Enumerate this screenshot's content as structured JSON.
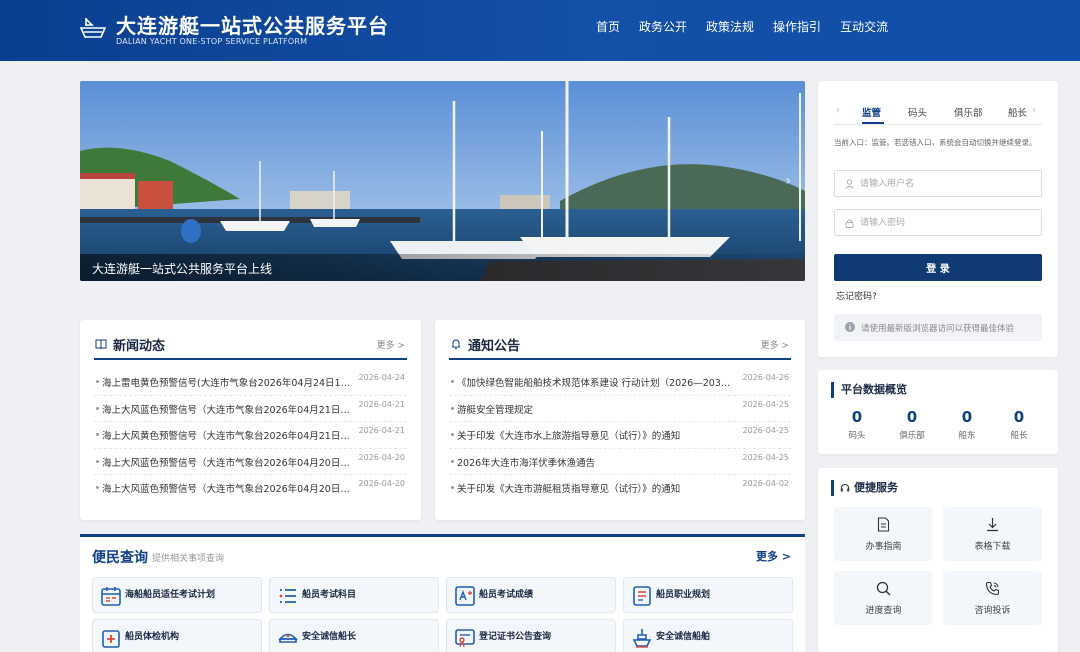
{
  "header": {
    "title": "大连游艇一站式公共服务平台",
    "subtitle": "DALIAN YACHT ONE-STOP SERVICE PLATFORM",
    "nav": [
      "首页",
      "政务公开",
      "政策法规",
      "操作指引",
      "互动交流"
    ]
  },
  "banner": {
    "caption": "大连游艇一站式公共服务平台上线"
  },
  "news": {
    "title": "新闻动态",
    "more": "更多 >",
    "items": [
      {
        "text": "海上雷电黄色预警信号(大连市气象台2026年04月24日19时5…",
        "date": "2026-04-24"
      },
      {
        "text": "海上大风蓝色预警信号（大连市气象台2026年04月21日15…",
        "date": "2026-04-21"
      },
      {
        "text": "海上大风黄色预警信号（大连市气象台2026年04月21日14…",
        "date": "2026-04-21"
      },
      {
        "text": "海上大风蓝色预警信号（大连市气象台2026年04月20日15…",
        "date": "2026-04-20"
      },
      {
        "text": "海上大风蓝色预警信号（大连市气象台2026年04月20日08…",
        "date": "2026-04-20"
      }
    ]
  },
  "notice": {
    "title": "通知公告",
    "more": "更多 >",
    "items": [
      {
        "text": "《加快绿色智能船舶技术规范体系建设 行动计划（2026—2030年…",
        "date": "2026-04-26"
      },
      {
        "text": "游艇安全管理规定",
        "date": "2026-04-25"
      },
      {
        "text": "关于印发《大连市水上旅游指导意见（试行）》的通知",
        "date": "2026-04-25"
      },
      {
        "text": "2026年大连市海洋伏季休渔通告",
        "date": "2026-04-25"
      },
      {
        "text": "关于印发《大连市游艇租赁指导意见（试行）》的通知",
        "date": "2026-04-02"
      }
    ]
  },
  "query": {
    "title": "便民查询",
    "subtitle": "提供相关事项查询",
    "more": "更多 >",
    "items": [
      "海船船员适任考试计划",
      "船员考试科目",
      "船员考试成绩",
      "船员职业规划",
      "船员体检机构",
      "安全诚信船长",
      "登记证书公告查询",
      "安全诚信船舶"
    ],
    "icons": [
      "calendar-icon",
      "list-icon",
      "score-icon",
      "document-icon",
      "medical-icon",
      "captain-icon",
      "certificate-icon",
      "ship-icon"
    ]
  },
  "login": {
    "tabs": [
      "监管",
      "码头",
      "俱乐部",
      "船长"
    ],
    "tip": "当前入口：监管。若选错入口，系统会自动切换并继续登录。",
    "username_placeholder": "请输入用户名",
    "password_placeholder": "请输入密码",
    "button": "登 录",
    "forgot": "忘记密码?",
    "browser_tip": "请使用最新版浏览器访问以获得最佳体验"
  },
  "stats": {
    "title": "平台数据概览",
    "items": [
      {
        "value": "0",
        "label": "码头"
      },
      {
        "value": "0",
        "label": "俱乐部"
      },
      {
        "value": "0",
        "label": "船东"
      },
      {
        "value": "0",
        "label": "船长"
      }
    ]
  },
  "services": {
    "title": "便捷服务",
    "items": [
      "办事指南",
      "表格下载",
      "进度查询",
      "咨询投诉"
    ]
  },
  "colors": {
    "primary": "#0f3f86",
    "header_bg": "#1350a8",
    "login_button": "#0f3a73"
  }
}
